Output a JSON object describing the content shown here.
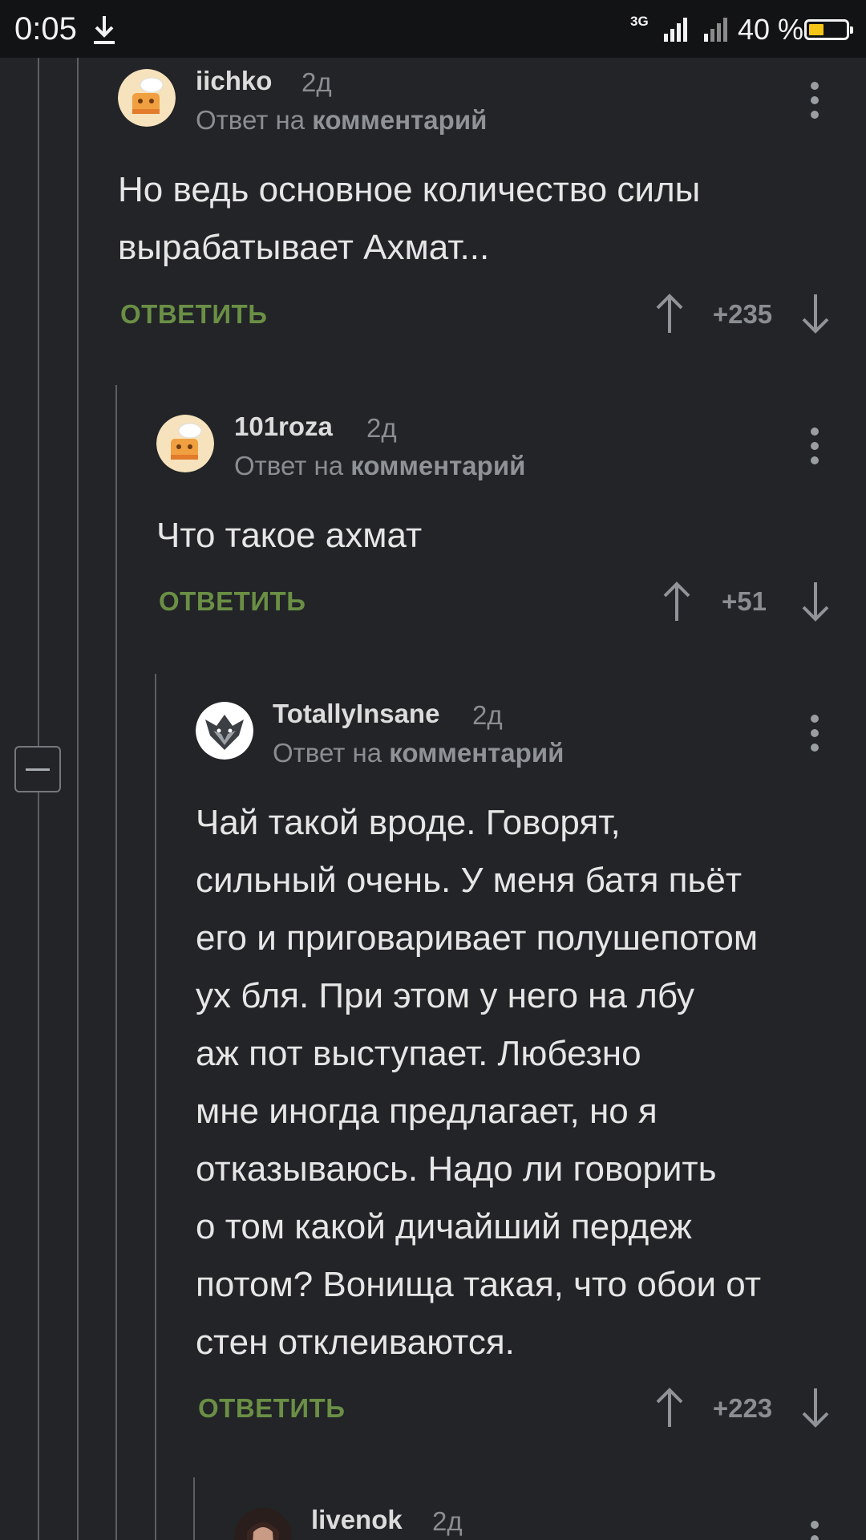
{
  "status_bar": {
    "time": "0:05",
    "network": "3G",
    "battery_text": "40 %",
    "battery_level": 0.4,
    "battery_color": "#f5c518"
  },
  "reply_to_prefix": "Ответ на",
  "reply_to_target": "комментарий",
  "reply_label": "ОТВЕТИТЬ",
  "comments": [
    {
      "username": "iichko",
      "age": "2д",
      "avatar": "chef-avatar",
      "lines": [
        "Но ведь основное количество силы",
        "вырабатывает Ахмат..."
      ],
      "score": "+235"
    },
    {
      "username": "101roza",
      "age": "2д",
      "avatar": "chef-avatar",
      "lines": [
        "Что такое ахмат"
      ],
      "score": "+51"
    },
    {
      "username": "TotallyInsane",
      "age": "2д",
      "avatar": "wolf-avatar",
      "lines": [
        "Чай такой вроде. Говорят,",
        "сильный очень. У меня батя пьёт",
        "его и приговаривает полушепотом",
        "ух бля. При этом у него на лбу",
        "аж пот выступает. Любезно",
        "мне иногда предлагает, но я",
        "отказываюсь. Надо ли говорить",
        "о том какой дичайший пердеж",
        "потом? Вонища такая, что обои от",
        "стен отклеиваются."
      ],
      "score": "+223"
    },
    {
      "username": "livenok",
      "age": "2д",
      "avatar": "woman-avatar"
    }
  ],
  "colors": {
    "background": "#222427",
    "reply_green": "#6a8f45",
    "muted": "#8a8d91"
  }
}
